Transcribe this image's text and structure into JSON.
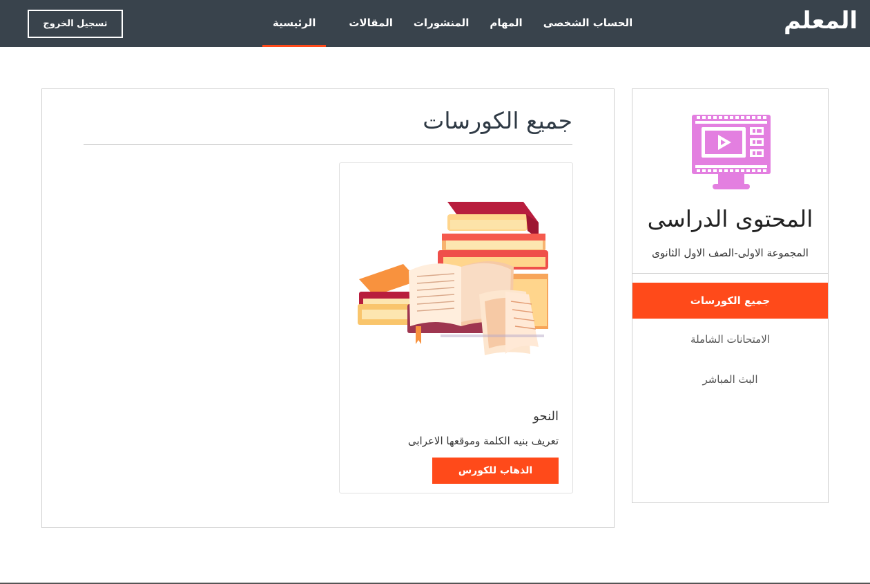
{
  "navbar": {
    "brand": "المعلم",
    "links": [
      "الرئيسية",
      "المقالات",
      "المنشورات",
      "المهام",
      "الحساب الشخصى"
    ],
    "active_index": 0,
    "logout_label": "تسجيل الخروج"
  },
  "sidebar": {
    "icon": "video-lesson-monitor-icon",
    "title": "المحتوى الدراسى",
    "subtitle": "المجموعة الاولى-الصف الاول الثانوى",
    "items": [
      "جميع الكورسات",
      "الامتحانات الشاملة",
      "البث المباشر"
    ],
    "active_index": 0
  },
  "main": {
    "title": "جميع الكورسات",
    "courses": [
      {
        "image": "books-stack-illustration",
        "title": "النحو",
        "description": "تعريف بنيه الكلمة وموقعها الاعرابى",
        "button_label": "الذهاب للكورس"
      }
    ]
  },
  "colors": {
    "navbar_bg": "#39434c",
    "accent": "#ff4a1a",
    "icon_pink": "#e37fe0"
  }
}
